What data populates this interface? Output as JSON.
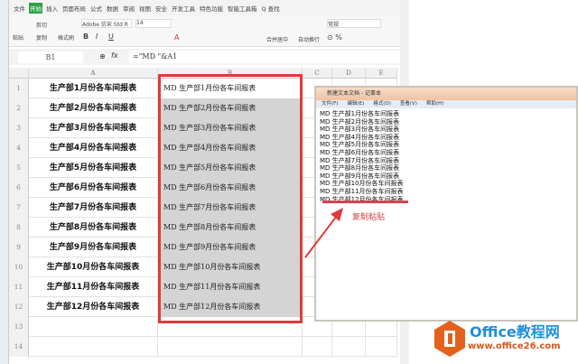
{
  "ribbon": {
    "menu": "文件",
    "tabs": [
      "开始",
      "插入",
      "页面布局",
      "公式",
      "数据",
      "审阅",
      "视图",
      "安全",
      "开发工具",
      "特色功能",
      "智能工具箱"
    ],
    "active_tab": "开始",
    "search": "Q 查找",
    "paste": "粘贴",
    "cut": "剪切",
    "copy": "复制",
    "format_painter": "格式刷",
    "font": "Adobe 仿宋 Std R",
    "font_size": "14",
    "merge": "合并居中",
    "wrap": "自动换行",
    "number_format": "常规"
  },
  "formula_bar": {
    "cell_ref": "B1",
    "fx": "fx",
    "formula": "=\"MD \"&A1"
  },
  "columns": [
    "A",
    "B",
    "C",
    "D",
    "E"
  ],
  "rows": [
    {
      "n": "1",
      "a": "生产部1月份各车间报表",
      "b": "MD 生产部1月份各车间报表"
    },
    {
      "n": "2",
      "a": "生产部2月份各车间报表",
      "b": "MD 生产部2月份各车间报表"
    },
    {
      "n": "3",
      "a": "生产部3月份各车间报表",
      "b": "MD 生产部3月份各车间报表"
    },
    {
      "n": "4",
      "a": "生产部4月份各车间报表",
      "b": "MD 生产部4月份各车间报表"
    },
    {
      "n": "5",
      "a": "生产部5月份各车间报表",
      "b": "MD 生产部5月份各车间报表"
    },
    {
      "n": "6",
      "a": "生产部6月份各车间报表",
      "b": "MD 生产部6月份各车间报表"
    },
    {
      "n": "7",
      "a": "生产部7月份各车间报表",
      "b": "MD 生产部7月份各车间报表"
    },
    {
      "n": "8",
      "a": "生产部8月份各车间报表",
      "b": "MD 生产部8月份各车间报表"
    },
    {
      "n": "9",
      "a": "生产部9月份各车间报表",
      "b": "MD 生产部9月份各车间报表"
    },
    {
      "n": "10",
      "a": "生产部10月份各车间报表",
      "b": "MD 生产部10月份各车间报表"
    },
    {
      "n": "11",
      "a": "生产部11月份各车间报表",
      "b": "MD 生产部11月份各车间报表"
    },
    {
      "n": "12",
      "a": "生产部12月份各车间报表",
      "b": "MD 生产部12月份各车间报表"
    },
    {
      "n": "13",
      "a": "",
      "b": ""
    },
    {
      "n": "14",
      "a": "",
      "b": ""
    }
  ],
  "notepad": {
    "title": "新建文本文档 - 记事本",
    "menu": [
      "文件(F)",
      "编辑(E)",
      "格式(O)",
      "查看(V)",
      "帮助(H)"
    ],
    "lines": [
      "MD 生产部1月份各车间报表",
      "MD 生产部2月份各车间报表",
      "MD 生产部3月份各车间报表",
      "MD 生产部4月份各车间报表",
      "MD 生产部5月份各车间报表",
      "MD 生产部6月份各车间报表",
      "MD 生产部7月份各车间报表",
      "MD 生产部8月份各车间报表",
      "MD 生产部9月份各车间报表",
      "MD 生产部10月份各车间报表",
      "MD 生产部11月份各车间报表",
      "MD 生产部12月份各车间报表"
    ]
  },
  "annotation": "复制粘贴",
  "watermark": {
    "line1": "Office教程网",
    "line2": "www.office26.com"
  },
  "colors": {
    "accent": "#2fa14b",
    "highlight": "#e03a3a"
  }
}
